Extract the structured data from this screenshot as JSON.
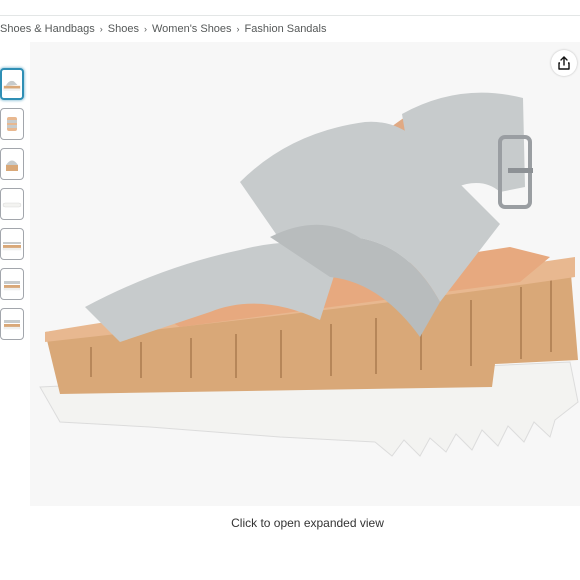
{
  "breadcrumb": [
    {
      "label": "Shoes & Handbags"
    },
    {
      "label": "Shoes"
    },
    {
      "label": "Women's Shoes"
    },
    {
      "label": "Fashion Sandals"
    }
  ],
  "breadcrumb_separator": "›",
  "gallery": {
    "thumbnails": [
      {
        "view": "side",
        "selected": true
      },
      {
        "view": "front"
      },
      {
        "view": "front-strap"
      },
      {
        "view": "sole"
      },
      {
        "view": "side-alt"
      },
      {
        "view": "top"
      },
      {
        "view": "pair"
      }
    ],
    "share_icon": "share-icon",
    "caption": "Click to open expanded view"
  },
  "colors": {
    "strap": "#c7cbcc",
    "footbed": "#e8b890",
    "cork": "#d9a878",
    "sole": "#f3f3f1",
    "selected_border": "#2f8fb5",
    "stage_background": "#f7f7f7"
  }
}
